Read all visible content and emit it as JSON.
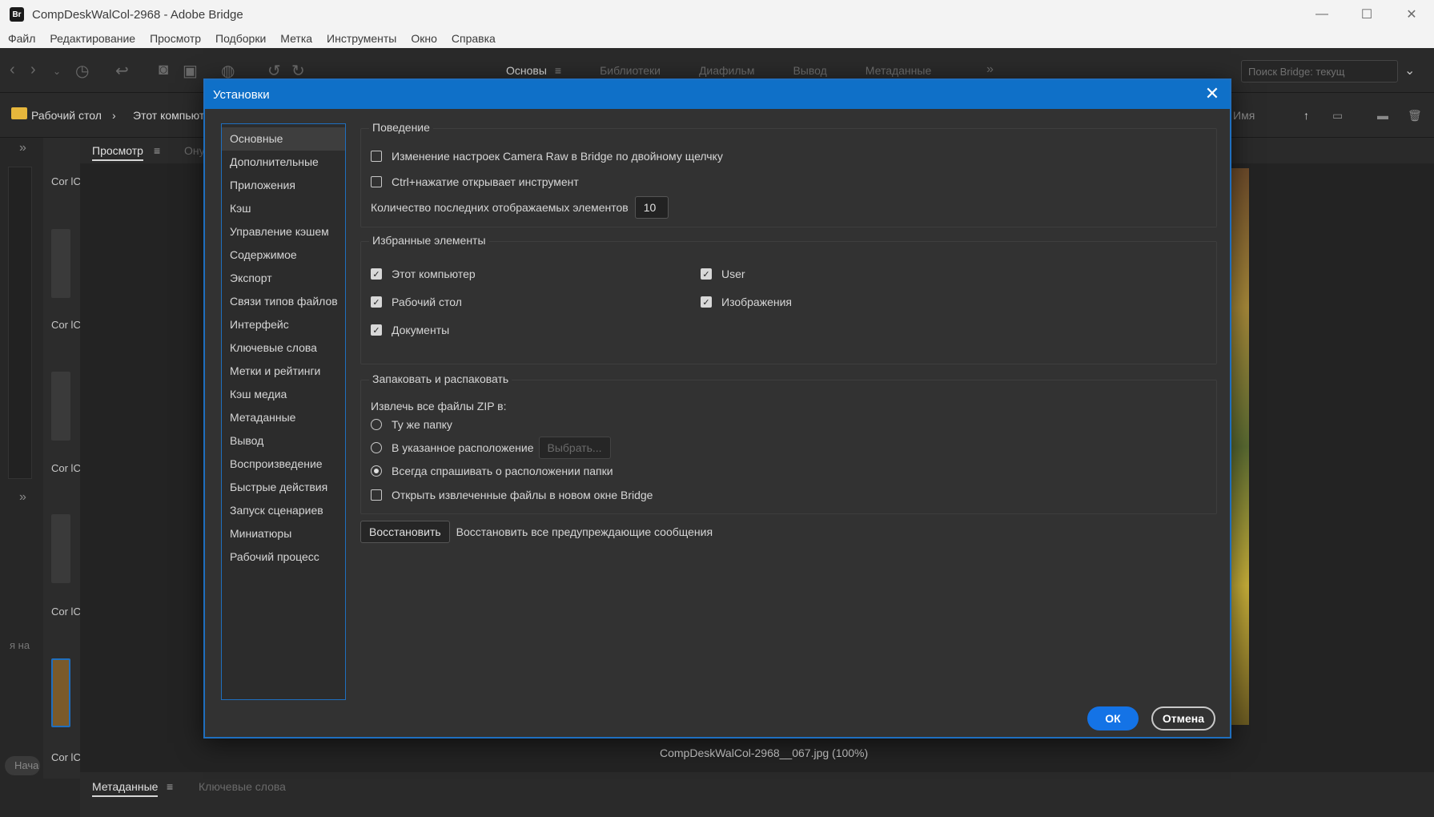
{
  "window": {
    "app_badge": "Br",
    "title": "CompDeskWalCol-2968 - Adobe Bridge",
    "controls": [
      "—",
      "☐",
      "✕"
    ]
  },
  "menu": [
    "Файл",
    "Редактирование",
    "Просмотр",
    "Подборки",
    "Метка",
    "Инструменты",
    "Окно",
    "Справка"
  ],
  "toolbar": {
    "workspaces": [
      "Основы",
      "Библиотеки",
      "Диафильм",
      "Вывод",
      "Метаданные"
    ],
    "workspace_menu_icon": "≡",
    "overflow_icon": "»",
    "search_placeholder": "Поиск Bridge: текущ"
  },
  "pathbar": {
    "items": [
      "Рабочий стол",
      "Этот компьют"
    ],
    "sort_label": "Имя"
  },
  "panels": {
    "preview_tab": "Просмотр",
    "preview_tab2": "Ону",
    "preview_caption": "CompDeskWalCol-2968__067.jpg (100%)",
    "bottom_tabs": [
      "Метаданные",
      "Ключевые слова"
    ],
    "thumb_labels": [
      "Cor\nlCol",
      "Cor\nlCol",
      "Cor\nlCol",
      "Cor\nlCol",
      "Cor\nlCol"
    ],
    "left_hint": "я на",
    "left_start": "Нача"
  },
  "dialog": {
    "title": "Установки",
    "nav": [
      "Основные",
      "Дополнительные",
      "Приложения",
      "Кэш",
      "Управление кэшем",
      "Содержимое",
      "Экспорт",
      "Связи типов файлов",
      "Интерфейс",
      "Ключевые слова",
      "Метки и рейтинги",
      "Кэш медиа",
      "Метаданные",
      "Вывод",
      "Воспроизведение",
      "Быстрые действия",
      "Запуск сценариев",
      "Миниатюры",
      "Рабочий процесс"
    ],
    "selected_nav": "Основные",
    "behavior": {
      "title": "Поведение",
      "camera_raw": "Изменение настроек Camera Raw в Bridge по двойному щелчку",
      "ctrl_click": "Ctrl+нажатие открывает инструмент",
      "recent_label": "Количество последних отображаемых элементов",
      "recent_value": "10"
    },
    "favorites": {
      "title": "Избранные элементы",
      "this_computer": "Этот компьютер",
      "desktop": "Рабочий стол",
      "documents": "Документы",
      "user": "User",
      "images": "Изображения"
    },
    "zip": {
      "title": "Запаковать и распаковать",
      "extract_label": "Извлечь все файлы ZIP в:",
      "same_folder": "Ту же папку",
      "specified": "В указанное расположение",
      "choose": "Выбрать...",
      "always_ask": "Всегда спрашивать о расположении папки",
      "open_new_window": "Открыть извлеченные файлы в новом окне Bridge"
    },
    "restore_button": "Восстановить",
    "restore_label": "Восстановить все предупреждающие сообщения",
    "ok": "ОК",
    "cancel": "Отмена"
  },
  "colors": {
    "accent": "#1473e6",
    "titlebar": "#0f70c8"
  }
}
